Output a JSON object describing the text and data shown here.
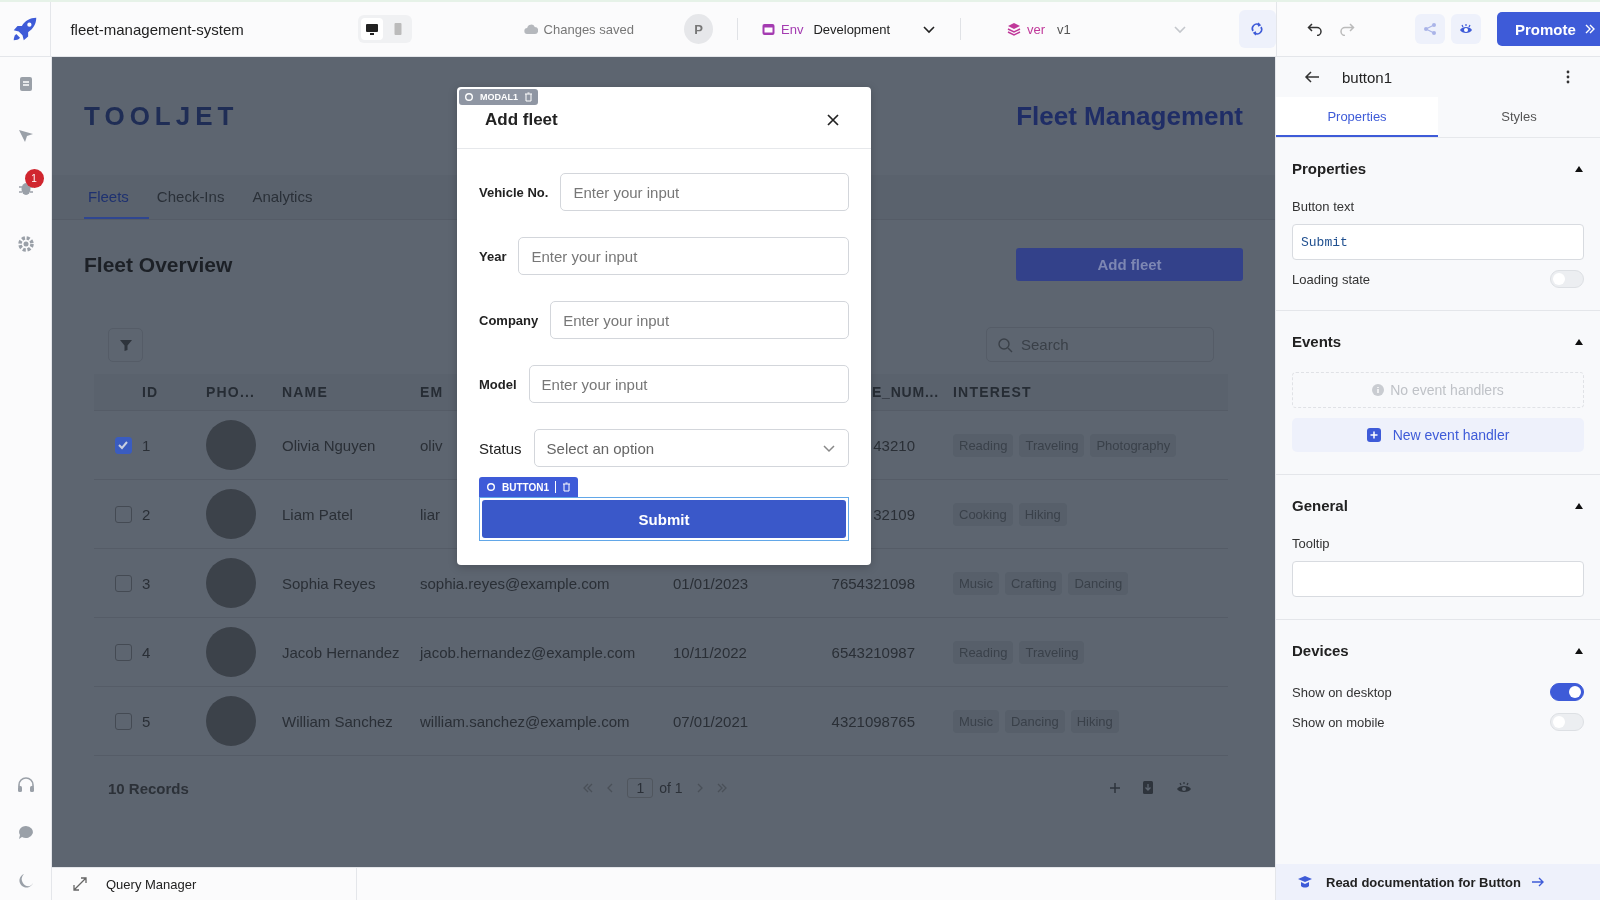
{
  "topbar": {
    "app_name": "fleet-management-system",
    "device_modes": [
      {
        "kind": "desktop",
        "selected": true
      },
      {
        "kind": "mobile",
        "selected": false
      }
    ],
    "save_status": "Changes saved",
    "avatar": "P",
    "env": {
      "label": "Env",
      "value": "Development"
    },
    "version": {
      "label": "ver",
      "value": "v1"
    },
    "promote": "Promote"
  },
  "rail": {
    "notification_count": "1"
  },
  "canvas": {
    "logo": "TOOLJET",
    "title": "Fleet Management",
    "tabs": [
      {
        "label": "Fleets",
        "selected": true
      },
      {
        "label": "Check-Ins",
        "selected": false
      },
      {
        "label": "Analytics",
        "selected": false
      }
    ],
    "heading": "Fleet Overview",
    "add_button": "Add fleet",
    "search": {
      "placeholder": "Search"
    },
    "table": {
      "columns": [
        {
          "kind": "id",
          "label": "ID"
        },
        {
          "kind": "photo",
          "label": "PHO..."
        },
        {
          "kind": "name",
          "label": "NAME"
        },
        {
          "kind": "email",
          "label": "EM"
        },
        {
          "kind": "phone",
          "label": "E_NUM..."
        },
        {
          "kind": "interest",
          "label": "INTEREST"
        }
      ],
      "rows": [
        {
          "checked": true,
          "id": "1",
          "name": "Olivia Nguyen",
          "email": "oliv",
          "phone": "43210",
          "interests": [
            "Reading",
            "Traveling",
            "Photography"
          ]
        },
        {
          "checked": false,
          "id": "2",
          "name": "Liam Patel",
          "email": "liar",
          "phone": "32109",
          "interests": [
            "Cooking",
            "Hiking"
          ]
        },
        {
          "checked": false,
          "id": "3",
          "name": "Sophia Reyes",
          "email": "sophia.reyes@example.com",
          "date": "01/01/2023",
          "phone": "7654321098",
          "interests": [
            "Music",
            "Crafting",
            "Dancing"
          ]
        },
        {
          "checked": false,
          "id": "4",
          "name": "Jacob Hernandez",
          "email": "jacob.hernandez@example.com",
          "date": "10/11/2022",
          "phone": "6543210987",
          "interests": [
            "Reading",
            "Traveling"
          ]
        },
        {
          "checked": false,
          "id": "5",
          "name": "William Sanchez",
          "email": "william.sanchez@example.com",
          "date": "07/01/2021",
          "phone": "4321098765",
          "interests": [
            "Music",
            "Dancing",
            "Hiking"
          ]
        }
      ],
      "records": "10 Records",
      "page": "1",
      "page_of": "of 1"
    }
  },
  "modal": {
    "badge": "MODAL1",
    "title": "Add fleet",
    "fields": [
      {
        "kind": "input",
        "label": "Vehicle No.",
        "placeholder": "Enter your input"
      },
      {
        "kind": "input",
        "label": "Year",
        "placeholder": "Enter your input"
      },
      {
        "kind": "input",
        "label": "Company",
        "placeholder": "Enter your input"
      },
      {
        "kind": "input",
        "label": "Model",
        "placeholder": "Enter your input"
      },
      {
        "kind": "select",
        "label": "Status",
        "placeholder": "Select an option"
      }
    ],
    "button_badge": "BUTTON1",
    "submit": "Submit"
  },
  "inspector": {
    "component": "button1",
    "tabs": [
      {
        "label": "Properties",
        "selected": true
      },
      {
        "label": "Styles",
        "selected": false
      }
    ],
    "properties": {
      "title": "Properties",
      "button_text_label": "Button text",
      "button_text": "Submit",
      "loading_label": "Loading state",
      "loading": false
    },
    "events": {
      "title": "Events",
      "empty": "No event handlers",
      "new_handler": "New event handler"
    },
    "general": {
      "title": "General",
      "tooltip_label": "Tooltip"
    },
    "devices": {
      "title": "Devices",
      "items": [
        {
          "label": "Show on desktop",
          "on": true
        },
        {
          "label": "Show on mobile",
          "on": false
        }
      ]
    },
    "docs_link": "Read documentation for Button"
  },
  "query_manager": "Query Manager"
}
